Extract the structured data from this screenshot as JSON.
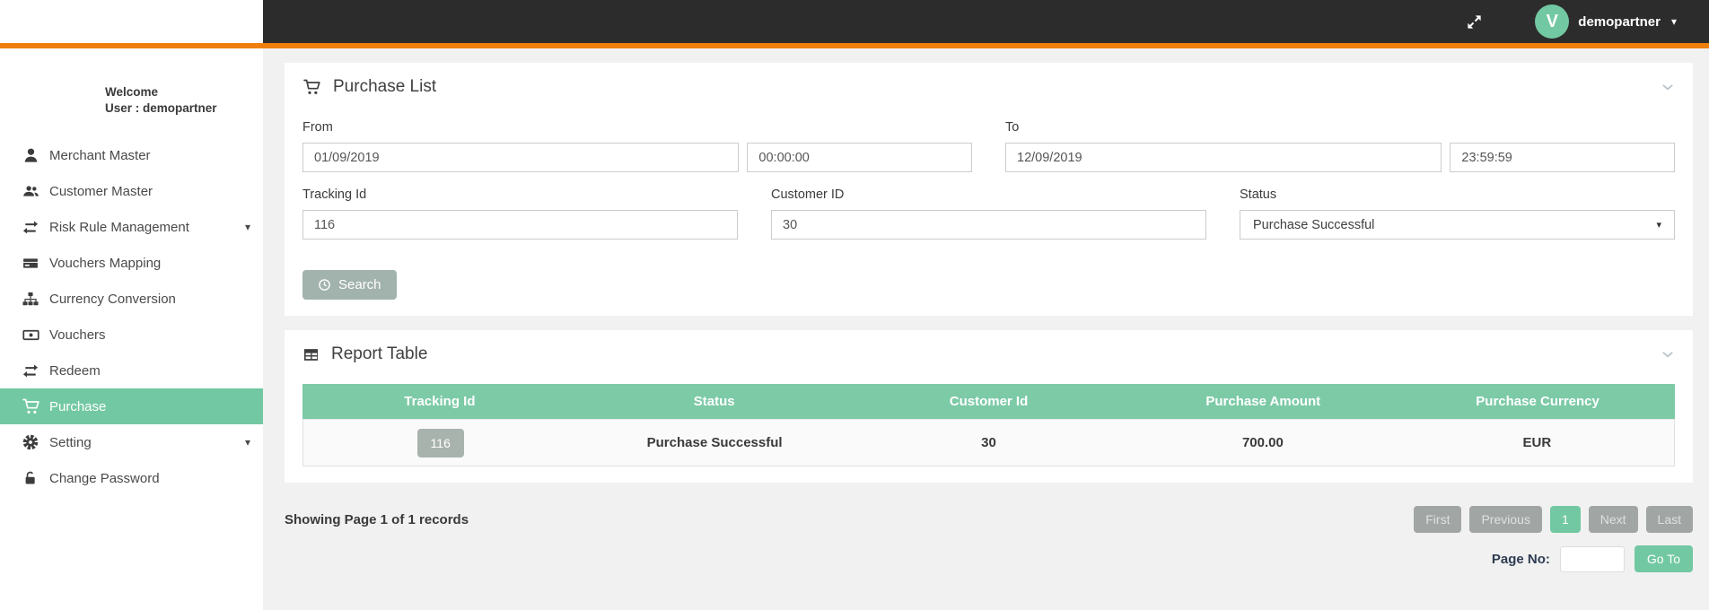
{
  "colors": {
    "accent_green": "#72c8a2",
    "table_header_green": "#7ccaa6",
    "orange_bar": "#ee7f0d",
    "topbar_dark": "#2c2c2c",
    "muted_button_gray": "#a2b2ad"
  },
  "topbar": {
    "avatar_letter": "V",
    "user_name": "demopartner",
    "icons": [
      "expand-icon",
      "chevron-down-icon"
    ]
  },
  "sidebar": {
    "welcome_line1": "Welcome",
    "welcome_line2": "User : demopartner",
    "items": [
      {
        "label": "Merchant Master",
        "icon": "user-icon",
        "active": false,
        "has_caret": false
      },
      {
        "label": "Customer Master",
        "icon": "users-icon",
        "active": false,
        "has_caret": false
      },
      {
        "label": "Risk Rule Management",
        "icon": "exchange-icon",
        "active": false,
        "has_caret": true
      },
      {
        "label": "Vouchers Mapping",
        "icon": "credit-card-icon",
        "active": false,
        "has_caret": false
      },
      {
        "label": "Currency Conversion",
        "icon": "sitemap-icon",
        "active": false,
        "has_caret": false
      },
      {
        "label": "Vouchers",
        "icon": "money-bill-icon",
        "active": false,
        "has_caret": false
      },
      {
        "label": "Redeem",
        "icon": "exchange-icon",
        "active": false,
        "has_caret": false
      },
      {
        "label": "Purchase",
        "icon": "cart-icon",
        "active": true,
        "has_caret": false
      },
      {
        "label": "Setting",
        "icon": "gear-icon",
        "active": false,
        "has_caret": true
      },
      {
        "label": "Change Password",
        "icon": "lock-icon",
        "active": false,
        "has_caret": false
      }
    ]
  },
  "purchase_list": {
    "title": "Purchase List",
    "title_icon": "cart-icon",
    "from_label": "From",
    "from_date": "01/09/2019",
    "from_time": "00:00:00",
    "to_label": "To",
    "to_date": "12/09/2019",
    "to_time": "23:59:59",
    "tracking_label": "Tracking Id",
    "tracking_value": "116",
    "customer_label": "Customer ID",
    "customer_value": "30",
    "status_label": "Status",
    "status_value": "Purchase Successful",
    "search_label": "Search",
    "search_icon": "clock-icon"
  },
  "report_table": {
    "title": "Report Table",
    "title_icon": "table-icon",
    "columns": [
      "Tracking Id",
      "Status",
      "Customer Id",
      "Purchase Amount",
      "Purchase Currency"
    ],
    "rows": [
      [
        "116",
        "Purchase Successful",
        "30",
        "700.00",
        "EUR"
      ]
    ]
  },
  "footer": {
    "showing_text": "Showing Page 1 of 1 records",
    "pagination": {
      "first": "First",
      "previous": "Previous",
      "current": "1",
      "next": "Next",
      "last": "Last"
    },
    "page_no_label": "Page No:",
    "goto_label": "Go To"
  }
}
